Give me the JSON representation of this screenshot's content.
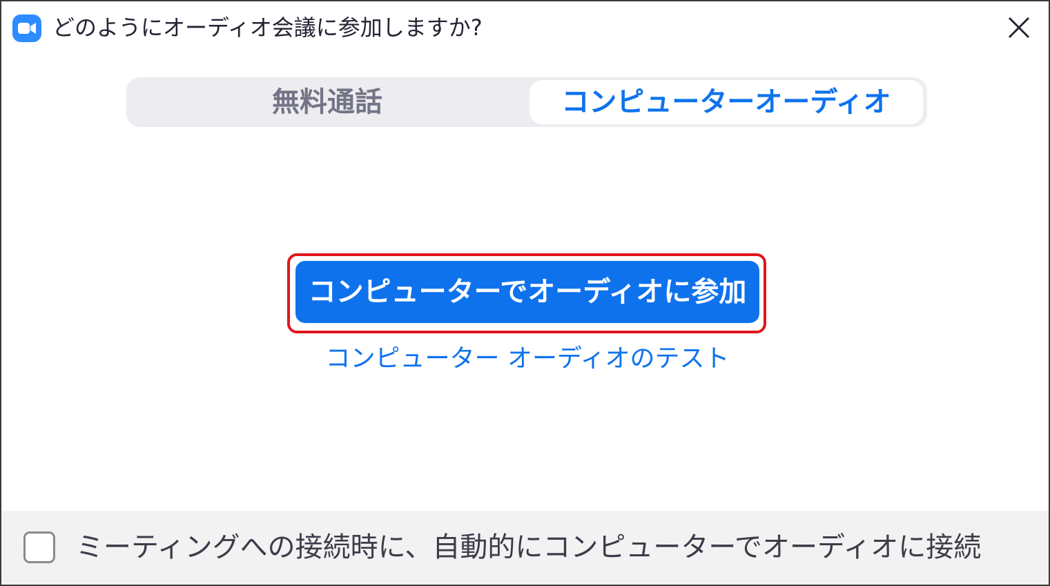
{
  "window": {
    "title": "どのようにオーディオ会議に参加しますか?",
    "app_icon": "zoom-camera-icon",
    "close_icon": "close-icon"
  },
  "tabs": [
    {
      "label": "無料通話",
      "selected": false
    },
    {
      "label": "コンピューターオーディオ",
      "selected": true
    }
  ],
  "main": {
    "join_button_label": "コンピューターでオーディオに参加",
    "test_link_label": "コンピューター オーディオのテスト"
  },
  "footer": {
    "auto_join_label": "ミーティングへの接続時に、自動的にコンピューターでオーディオに接続",
    "auto_join_checked": false
  },
  "colors": {
    "accent": "#0e72ed",
    "highlight": "#e0161d",
    "tab_bg": "#ededf1",
    "footer_bg": "#f2f2f2"
  }
}
